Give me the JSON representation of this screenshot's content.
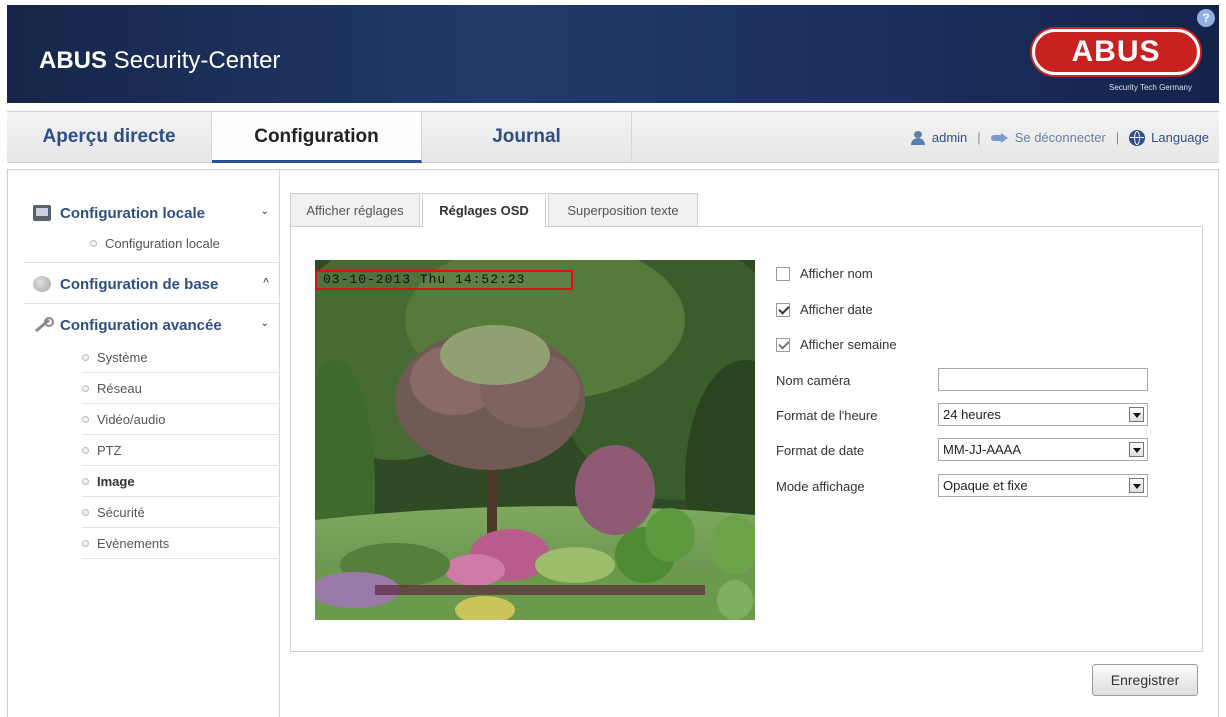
{
  "header": {
    "title_brand": "ABUS",
    "title_rest": " Security-Center",
    "logo_text": "ABUS",
    "logo_tagline": "Security Tech Germany",
    "help_icon": "?"
  },
  "main_tabs": [
    {
      "label": "Aperçu directe"
    },
    {
      "label": "Configuration"
    },
    {
      "label": "Journal"
    }
  ],
  "user_bar": {
    "user": "admin",
    "separator": "|",
    "logout": "Se déconnecter",
    "language": "Language"
  },
  "sidebar": {
    "sections": [
      {
        "label": "Configuration locale",
        "chevron": "⌄"
      },
      {
        "label": "Configuration de base",
        "chevron": "^"
      },
      {
        "label": "Configuration avancée",
        "chevron": "⌄"
      }
    ],
    "local_items": [
      "Configuration locale"
    ],
    "advanced_items": [
      {
        "label": "Système"
      },
      {
        "label": "Réseau"
      },
      {
        "label": "Vidéo/audio"
      },
      {
        "label": "PTZ"
      },
      {
        "label": "Image"
      },
      {
        "label": "Sécurité"
      },
      {
        "label": "Evènements"
      }
    ]
  },
  "sub_tabs": [
    {
      "label": "Afficher réglages"
    },
    {
      "label": "Réglages OSD"
    },
    {
      "label": "Superposition texte"
    }
  ],
  "preview": {
    "osd_text": "03-10-2013 Thu 14:52:23"
  },
  "osd_form": {
    "show_name": {
      "label": "Afficher nom",
      "checked": false
    },
    "show_date": {
      "label": "Afficher date",
      "checked": true
    },
    "show_week": {
      "label": "Afficher semaine",
      "checked": true
    },
    "camera_name": {
      "label": "Nom caméra",
      "value": ""
    },
    "time_format": {
      "label": "Format de l'heure",
      "value": "24 heures"
    },
    "date_format": {
      "label": "Format de date",
      "value": "MM-JJ-AAAA"
    },
    "display_mode": {
      "label": "Mode affichage",
      "value": "Opaque et fixe"
    }
  },
  "save_label": "Enregistrer"
}
